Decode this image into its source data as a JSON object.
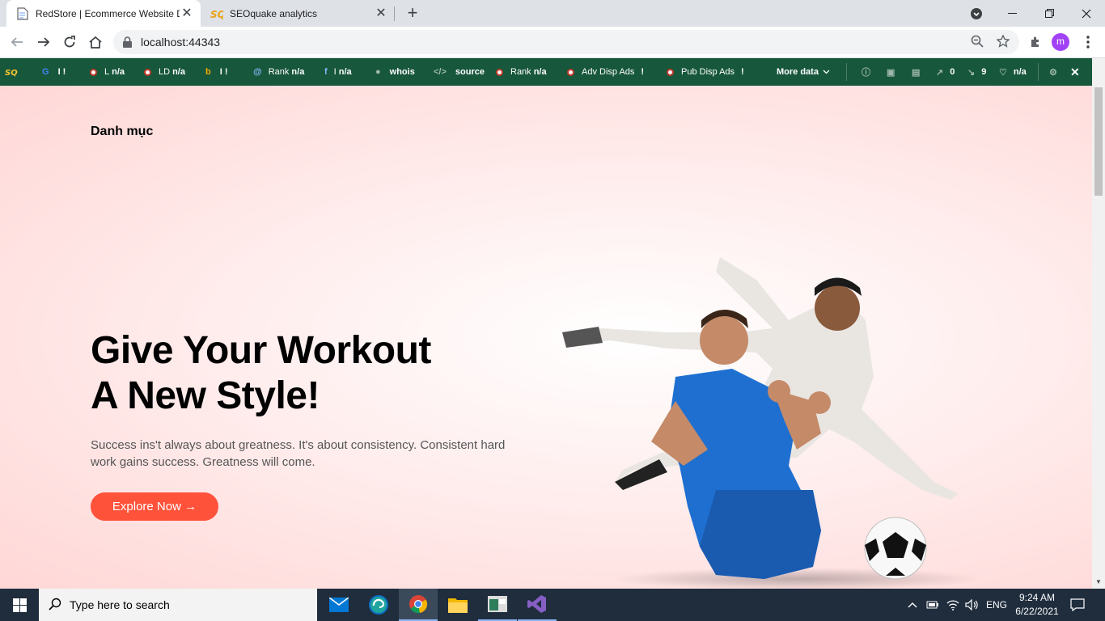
{
  "browser": {
    "tabs": [
      {
        "title": "RedStore | Ecommerce Website D",
        "active": true
      },
      {
        "title": "SEOquake analytics",
        "active": false
      }
    ],
    "url": "localhost:44343",
    "profile_initial": "m"
  },
  "seoquake": {
    "items": [
      {
        "label": "",
        "value": "I !",
        "icon": "google-icon"
      },
      {
        "label": "L",
        "value": "n/a",
        "icon": "dot-icon"
      },
      {
        "label": "LD",
        "value": "n/a",
        "icon": "dot-icon"
      },
      {
        "label": "",
        "value": "I !",
        "icon": "bing-icon"
      },
      {
        "label": "Rank",
        "value": "n/a",
        "icon": "alexa-icon"
      },
      {
        "label": "I",
        "value": "n/a",
        "icon": "facebook-icon"
      },
      {
        "label": "",
        "value": "whois",
        "icon": "user-icon"
      },
      {
        "label": "",
        "value": "source",
        "icon": "code-icon"
      },
      {
        "label": "Rank",
        "value": "n/a",
        "icon": "dot-icon"
      },
      {
        "label": "Adv Disp Ads",
        "value": "!",
        "icon": "dot-icon"
      },
      {
        "label": "Pub Disp Ads",
        "value": "!",
        "icon": "dot-icon"
      }
    ],
    "more_data": "More data",
    "right": [
      {
        "value": "",
        "icon": "info-icon"
      },
      {
        "value": "",
        "icon": "monitor-icon"
      },
      {
        "value": "",
        "icon": "chart-icon"
      },
      {
        "value": "0",
        "icon": "external-link-icon"
      },
      {
        "value": "9",
        "icon": "internal-link-icon"
      },
      {
        "value": "n/a",
        "icon": "heart-icon"
      }
    ]
  },
  "page": {
    "nav_title": "Danh mục",
    "headline_line1": "Give Your Workout",
    "headline_line2": "A New Style!",
    "subtext": "Success ins't always about greatness. It's about consistency. Consistent hard work gains success. Greatness will come.",
    "cta_label": "Explore Now →"
  },
  "taskbar": {
    "search_placeholder": "Type here to search",
    "language": "ENG",
    "time": "9:24 AM",
    "date": "6/22/2021"
  },
  "colors": {
    "seobar": "#17573c",
    "cta": "#ff523b",
    "accent": "#a142f4"
  }
}
